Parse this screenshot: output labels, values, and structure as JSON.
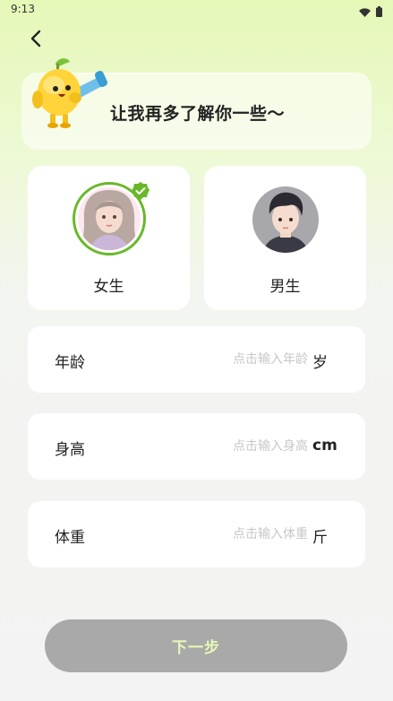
{
  "status_bar": {
    "time": "9:13"
  },
  "banner": {
    "text": "让我再多了解你一些～"
  },
  "gender": {
    "female_label": "女生",
    "male_label": "男生",
    "selected": "female"
  },
  "fields": [
    {
      "label": "年龄",
      "placeholder": "点击输入年龄",
      "unit": "岁"
    },
    {
      "label": "身高",
      "placeholder": "点击输入身高",
      "unit": "cm"
    },
    {
      "label": "体重",
      "placeholder": "点击输入体重",
      "unit": "斤"
    }
  ],
  "next_button": {
    "label": "下一步"
  },
  "colors": {
    "accent_green": "#69b829",
    "button_disabled_bg": "#a9a9a9",
    "button_text": "#e6f8b7"
  },
  "icons": {
    "back": "chevron-left-icon",
    "wifi": "wifi-icon",
    "battery": "battery-icon",
    "check": "check-badge-icon"
  }
}
